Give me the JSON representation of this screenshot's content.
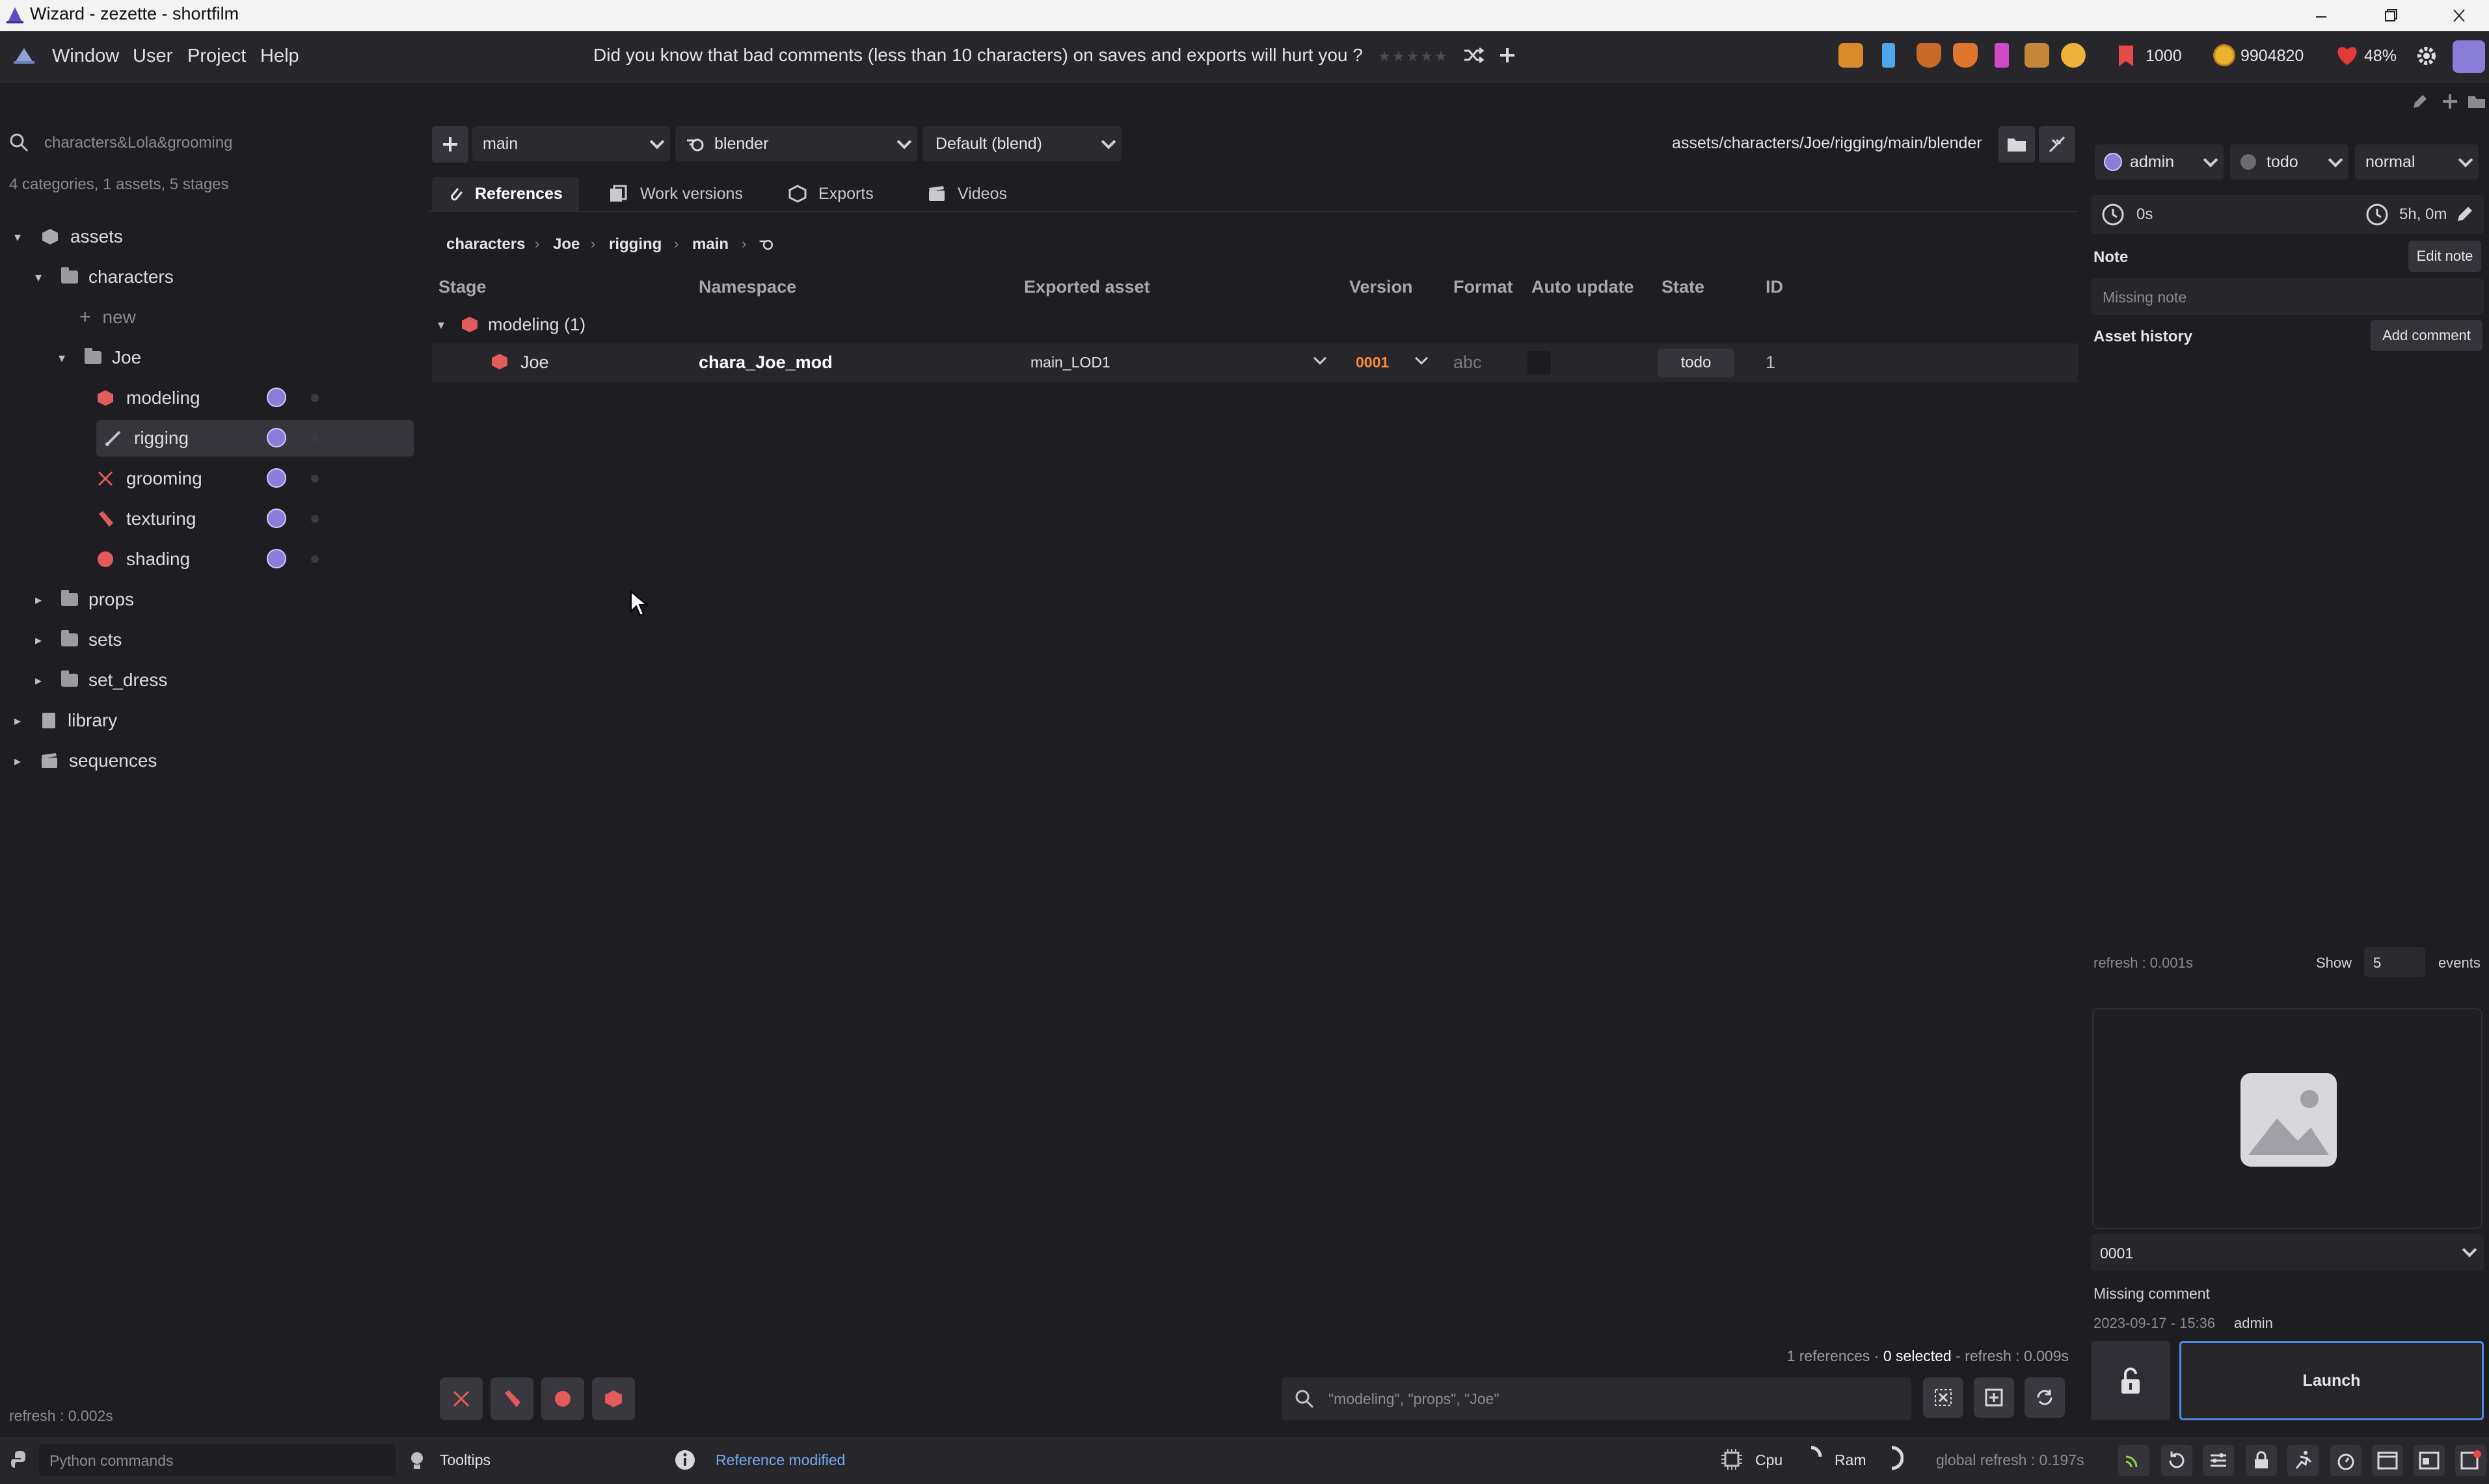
{
  "window": {
    "title": "Wizard - zezette - shortfilm"
  },
  "menu": {
    "items": [
      "Window",
      "User",
      "Project",
      "Help"
    ]
  },
  "tip": {
    "text": "Did you know that bad comments (less than 10 characters) on saves and exports will hurt you ?"
  },
  "stats": {
    "tickets": "1000",
    "coins": "9904820",
    "life": "48%"
  },
  "search": {
    "value": "characters&Lola&grooming",
    "summary": "4 categories, 1 assets, 5 stages"
  },
  "tree": {
    "root": "assets",
    "characters": "characters",
    "new": "new",
    "joe": "Joe",
    "stages": [
      "modeling",
      "rigging",
      "grooming",
      "texturing",
      "shading"
    ],
    "others": [
      "props",
      "sets",
      "set_dress"
    ],
    "library": "library",
    "sequences": "sequences",
    "refresh": "refresh : 0.002s"
  },
  "toolbar": {
    "variant": "main",
    "software": "blender",
    "extension": "Default (blend)",
    "path": "assets/characters/Joe/rigging/main/blender"
  },
  "tabs": [
    "References",
    "Work versions",
    "Exports",
    "Videos"
  ],
  "breadcrumb": [
    "characters",
    "Joe",
    "rigging",
    "main"
  ],
  "table": {
    "headers": [
      "Stage",
      "Namespace",
      "Exported asset",
      "Version",
      "Format",
      "Auto update",
      "State",
      "ID"
    ],
    "group": "modeling (1)",
    "row": {
      "stage": "Joe",
      "namespace": "chara_Joe_mod",
      "exported_asset": "main_LOD1",
      "version": "0001",
      "format": "abc",
      "state": "todo",
      "id": "1"
    }
  },
  "center_footer": {
    "references": "1 references",
    "selected": "0 selected",
    "refresh": "refresh : 0.009s",
    "search_placeholder": "\"modeling\", \"props\", \"Joe\""
  },
  "right": {
    "user": "admin",
    "state": "todo",
    "priority": "normal",
    "time_spent": "0s",
    "estimated": "5h, 0m",
    "note_label": "Note",
    "edit_note": "Edit note",
    "note_value": "Missing note",
    "history_label": "Asset history",
    "add_comment": "Add comment",
    "refresh": "refresh : 0.001s",
    "show_label": "Show",
    "show_value": "5",
    "events_label": "events",
    "version": "0001",
    "comment": "Missing comment",
    "date": "2023-09-17 - 15:36",
    "author": "admin",
    "launch": "Launch"
  },
  "bottom": {
    "python_placeholder": "Python commands",
    "tooltips": "Tooltips",
    "message": "Reference modified",
    "cpu": "Cpu",
    "ram": "Ram",
    "global_refresh": "global refresh : 0.197s"
  },
  "colors": {
    "accent": "#4e8ce0",
    "stage_red": "#e35b5b",
    "version_orange": "#ff8a3a",
    "background": "#1e1e22"
  }
}
